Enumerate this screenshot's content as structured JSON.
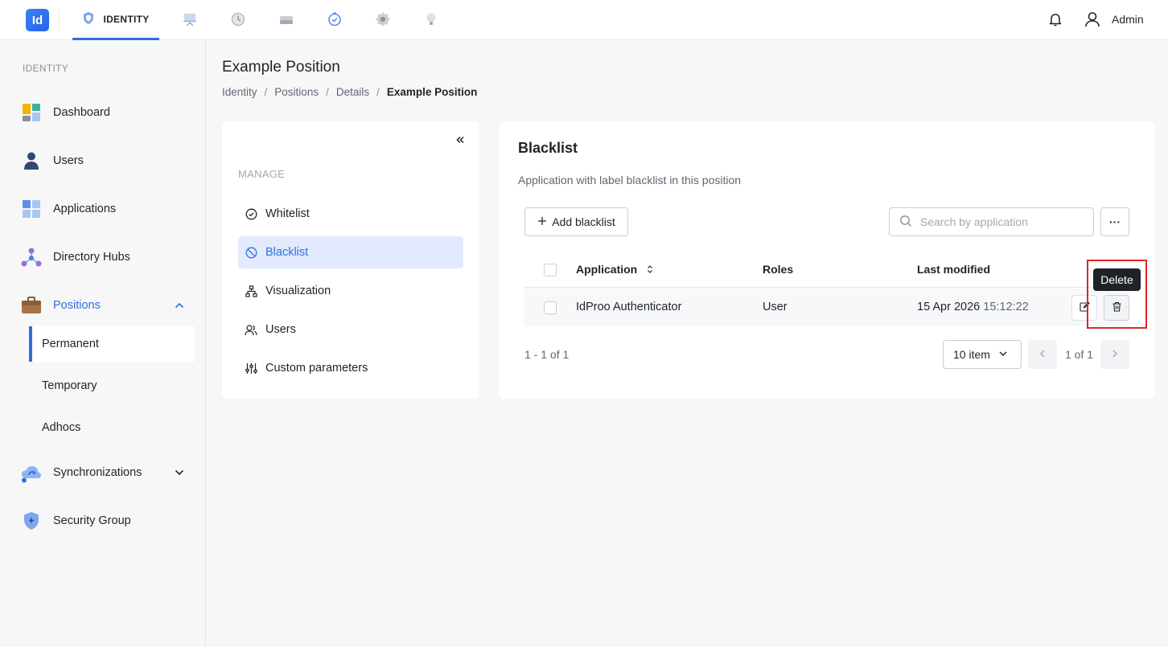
{
  "topbar": {
    "logo_text": "Id",
    "active_tab_label": "IDENTITY",
    "user_name": "Admin",
    "icons": [
      "shield-icon",
      "presentation-icon",
      "history-icon",
      "drive-icon",
      "clock-check-icon",
      "gear-icon",
      "bulb-icon"
    ]
  },
  "sidebar": {
    "section_label": "IDENTITY",
    "items": [
      {
        "label": "Dashboard",
        "icon": "dashboard-icon"
      },
      {
        "label": "Users",
        "icon": "user-icon"
      },
      {
        "label": "Applications",
        "icon": "applications-icon"
      },
      {
        "label": "Directory Hubs",
        "icon": "hub-icon"
      },
      {
        "label": "Positions",
        "icon": "briefcase-icon"
      },
      {
        "label": "Synchronizations",
        "icon": "cloud-sync-icon"
      },
      {
        "label": "Security Group",
        "icon": "shield-icon"
      }
    ],
    "positions_sub": [
      "Permanent",
      "Temporary",
      "Adhocs"
    ]
  },
  "page": {
    "title": "Example Position",
    "breadcrumb": [
      "Identity",
      "Positions",
      "Details",
      "Example Position"
    ]
  },
  "manage": {
    "label": "MANAGE",
    "items": [
      "Whitelist",
      "Blacklist",
      "Visualization",
      "Users",
      "Custom parameters"
    ]
  },
  "blacklist": {
    "title": "Blacklist",
    "description": "Application with label blacklist in this position",
    "add_button": "Add blacklist",
    "search_placeholder": "Search by application",
    "more_label": "···",
    "columns": {
      "application": "Application",
      "roles": "Roles",
      "last_modified": "Last modified"
    },
    "rows": [
      {
        "application": "IdProo Authenticator",
        "roles": "User",
        "date": "15 Apr 2026",
        "time": "15:12:22"
      }
    ],
    "tooltip": "Delete",
    "range_text": "1 - 1 of 1",
    "page_size": "10 item",
    "page_text": "1 of 1"
  },
  "colors": {
    "accent": "#2f6fdd",
    "active_bg": "#e3eafd",
    "highlight": "#e0242a"
  }
}
